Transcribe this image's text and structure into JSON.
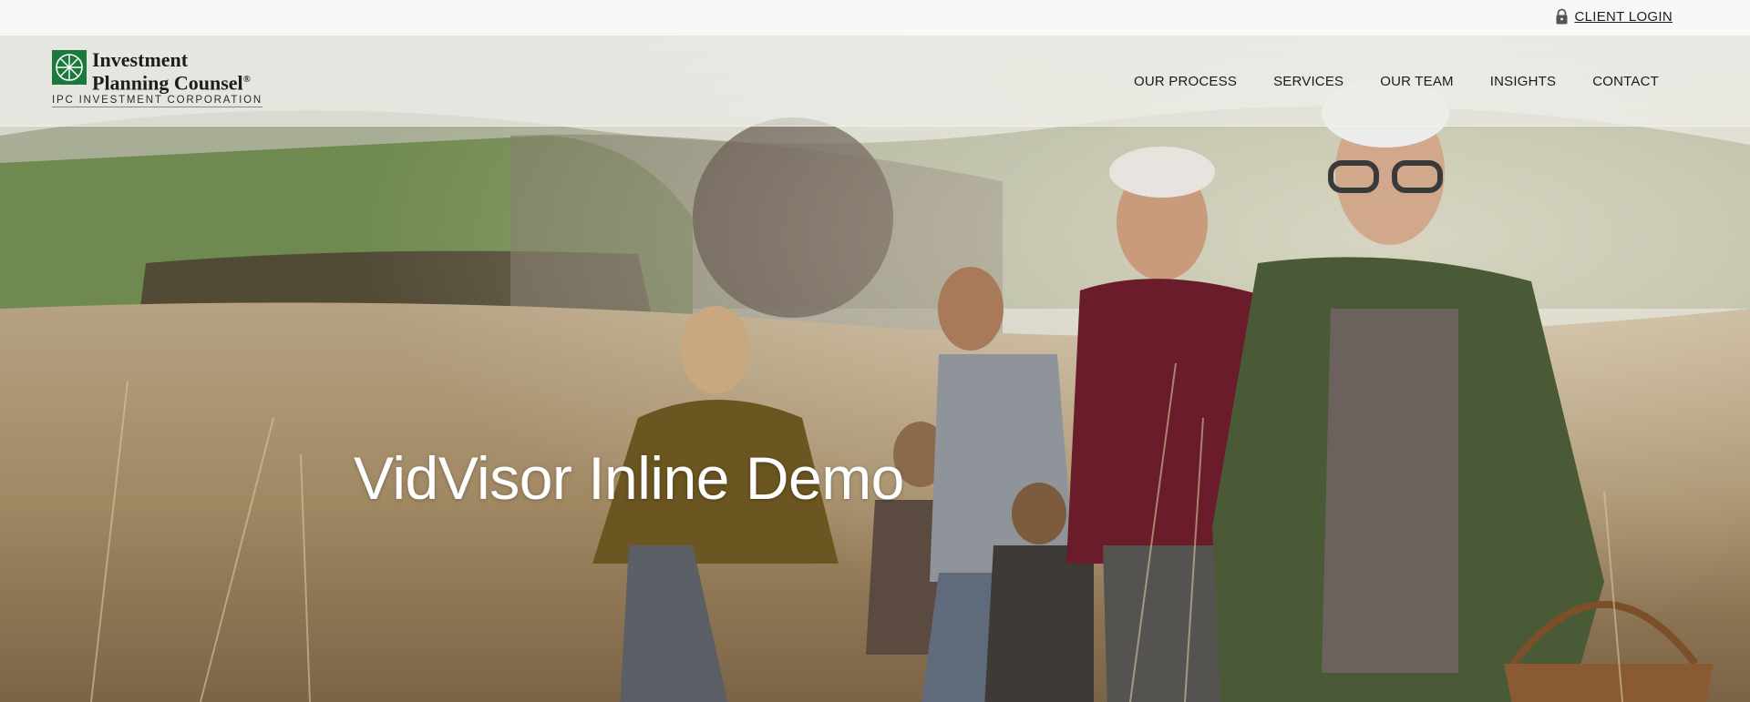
{
  "util_bar": {
    "login_label": "CLIENT LOGIN",
    "login_icon": "lock-icon"
  },
  "nav": {
    "logo": {
      "line1": "Investment",
      "line2": "Planning Counsel",
      "reg_mark": "®",
      "subline": "IPC INVESTMENT CORPORATION",
      "mark_color": "#1a7a3c"
    },
    "items": [
      {
        "label": "OUR PROCESS"
      },
      {
        "label": "SERVICES"
      },
      {
        "label": "OUR TEAM"
      },
      {
        "label": "INSIGHTS"
      },
      {
        "label": "CONTACT"
      }
    ]
  },
  "hero": {
    "title": "VidVisor Inline Demo"
  }
}
